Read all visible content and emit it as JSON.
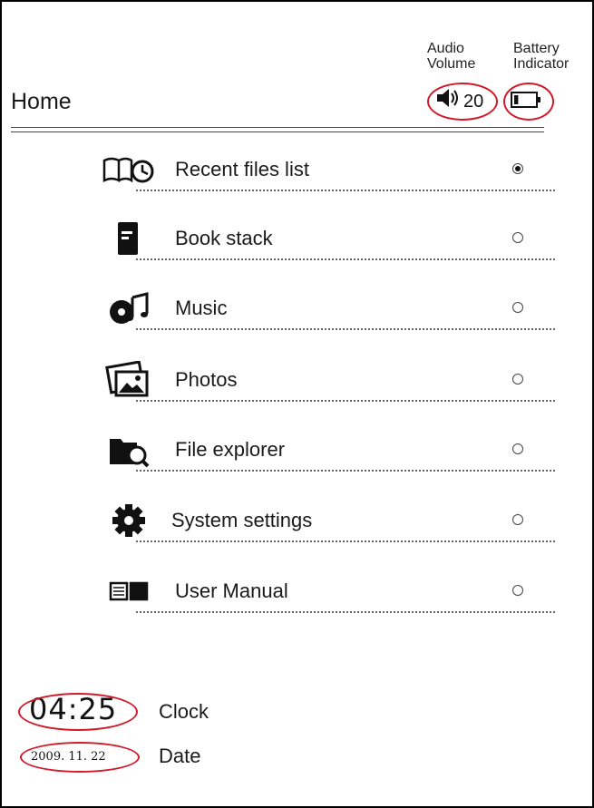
{
  "annotations": {
    "audio_line1": "Audio",
    "audio_line2": "Volume",
    "battery_line1": "Battery",
    "battery_line2": "Indicator",
    "clock_caption": "Clock",
    "date_caption": "Date"
  },
  "header": {
    "title": "Home",
    "volume_value": "20",
    "volume_icon": "speaker-icon",
    "battery_icon": "battery-icon",
    "battery_level_fraction": 0.2
  },
  "menu": {
    "items": [
      {
        "label": "Recent files list",
        "icon": "recent-files-icon",
        "selected": true
      },
      {
        "label": "Book stack",
        "icon": "book-icon",
        "selected": false
      },
      {
        "label": "Music",
        "icon": "music-icon",
        "selected": false
      },
      {
        "label": "Photos",
        "icon": "photos-icon",
        "selected": false
      },
      {
        "label": "File explorer",
        "icon": "folder-search-icon",
        "selected": false
      },
      {
        "label": "System settings",
        "icon": "gear-icon",
        "selected": false
      },
      {
        "label": "User Manual",
        "icon": "manual-icon",
        "selected": false
      }
    ]
  },
  "footer": {
    "clock": "04:25",
    "date": "2009. 11. 22"
  },
  "colors": {
    "highlight": "#d11a2a",
    "text": "#111111",
    "background": "#ffffff"
  }
}
